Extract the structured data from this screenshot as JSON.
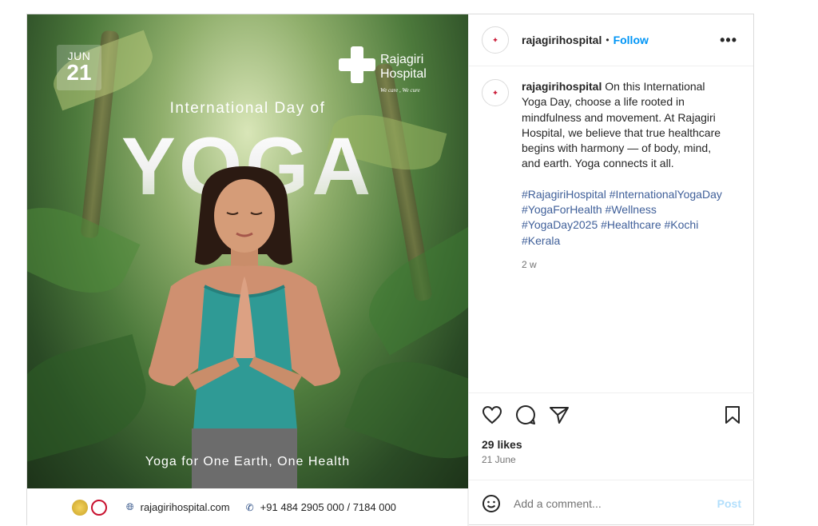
{
  "post_image": {
    "date_month": "JUN",
    "date_day": "21",
    "logo_line1": "Rajagiri",
    "logo_line2": "Hospital",
    "logo_tagline": "We care , We cure",
    "headline_small": "International Day of",
    "headline_big": "YOGA",
    "tagline": "Yoga for One Earth, One Health",
    "footer_website": "rajagirihospital.com",
    "footer_phone": "+91 484 2905 000 / 7184 000",
    "colors": {
      "brand_red": "#c8102e",
      "top_green": "#4d7a3c",
      "tank_top": "#2f9a95"
    }
  },
  "header": {
    "username": "rajagirihospital",
    "separator": "•",
    "follow_label": "Follow",
    "more_icon": "more-horizontal-icon"
  },
  "caption": {
    "username": "rajagirihospital",
    "text": "On this International Yoga Day, choose a life rooted in mindfulness and movement. At Rajagiri Hospital, we believe that true healthcare begins with harmony — of body, mind, and earth. Yoga connects it all.",
    "hashtags": "#RajagiriHospital #InternationalYogaDay #YogaForHealth #Wellness #YogaDay2025 #Healthcare #Kochi #Kerala",
    "time_ago": "2 w"
  },
  "actions": {
    "likes": "29 likes",
    "date": "21 June"
  },
  "comment": {
    "placeholder": "Add a comment...",
    "post_label": "Post"
  }
}
